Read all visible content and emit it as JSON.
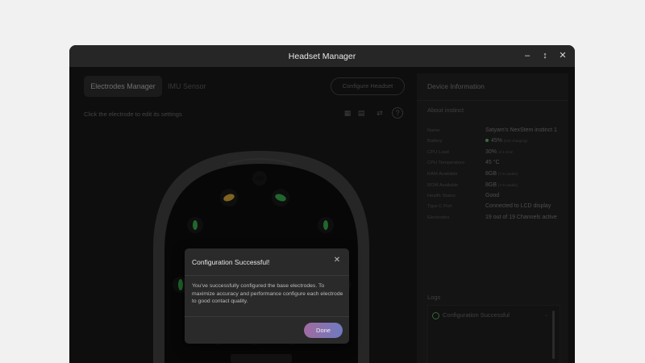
{
  "window": {
    "title": "Headset Manager",
    "controls": [
      "–",
      "↕",
      "✕"
    ]
  },
  "left": {
    "tabs": [
      {
        "label": "Electrodes Manager",
        "active": true
      },
      {
        "label": "IMU Sensor",
        "active": false
      }
    ],
    "configure_label": "Configure Headset",
    "hint": "Click the electrode to edit its settings"
  },
  "right": {
    "title": "Device Information",
    "section": "About instinct",
    "info": [
      {
        "label": "Name",
        "value": "Satyam's NexStem instinct 1",
        "note": ""
      },
      {
        "label": "Battery",
        "value": "45%",
        "note": "(Not charging)"
      },
      {
        "label": "CPU Load",
        "value": "30%",
        "note": "of 4 GHz"
      },
      {
        "label": "CPU Temperature",
        "value": "45 °C",
        "note": ""
      },
      {
        "label": "RAM Available",
        "value": "8GB",
        "note": "(7.9 usable)"
      },
      {
        "label": "ROM Available",
        "value": "8GB",
        "note": "(7.9 usable)"
      },
      {
        "label": "Health Status",
        "value": "Good",
        "note": ""
      },
      {
        "label": "Type C Port",
        "value": "Connected to LCD display",
        "note": ""
      },
      {
        "label": "Electrodes",
        "value": "19 out of 19 Channels active",
        "note": ""
      }
    ],
    "logs_title": "Logs",
    "logs": [
      {
        "text": "Configuration Successful"
      }
    ]
  },
  "modal": {
    "title": "Configuration Successful!",
    "text": "You've successfully configured the base electrodes. To maximize accuracy and performance configure each electrode to good contact quality.",
    "button": "Done"
  },
  "colors": {
    "electrode_green": "#2f8f3f",
    "electrode_yellow": "#b08a2c",
    "accent_gradient": "#a06ba0"
  }
}
